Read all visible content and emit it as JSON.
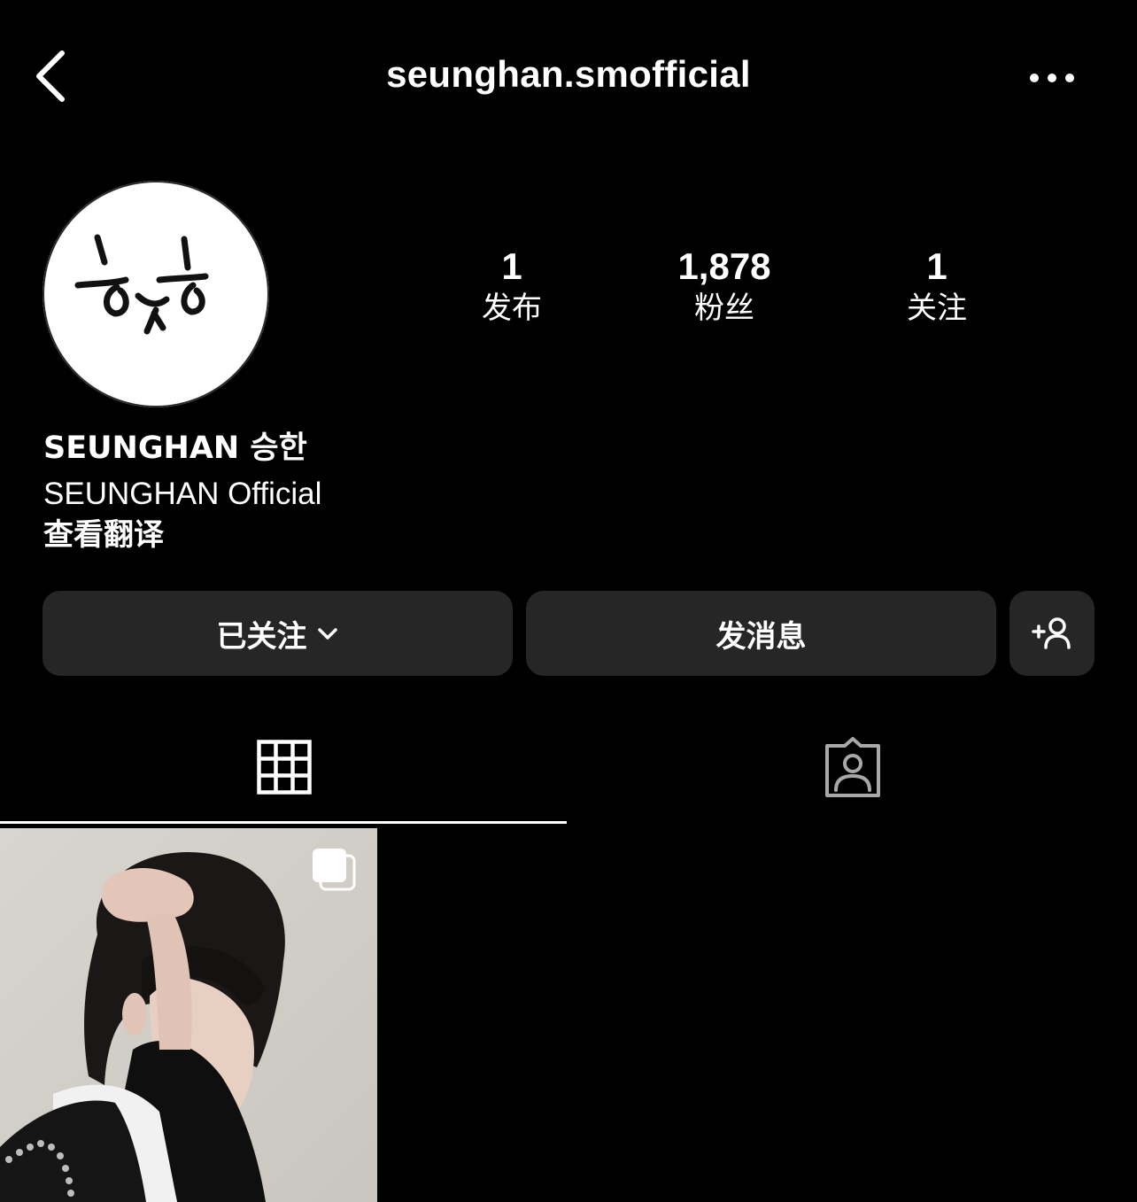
{
  "header": {
    "username": "seunghan.smofficial"
  },
  "stats": [
    {
      "value": "1",
      "label": "发布"
    },
    {
      "value": "1,878",
      "label": "粉丝"
    },
    {
      "value": "1",
      "label": "关注"
    }
  ],
  "profile": {
    "name": "SEUNGHAN 승한",
    "bio": "SEUNGHAN Official",
    "translate_link": "查看翻译"
  },
  "actions": {
    "following_label": "已关注",
    "message_label": "发消息"
  },
  "icons": {
    "back": "chevron-left-icon",
    "more": "more-horizontal-icon",
    "follow_dropdown": "chevron-down-icon",
    "add_user": "add-user-icon",
    "grid_tab": "grid-icon",
    "tagged_tab": "tagged-person-icon",
    "post_multi": "carousel-icon"
  },
  "tabs": {
    "active": "grid"
  },
  "colors": {
    "background": "#000000",
    "button_bg": "#262626",
    "text": "#ffffff",
    "inactive_icon": "#a8a8a8"
  }
}
